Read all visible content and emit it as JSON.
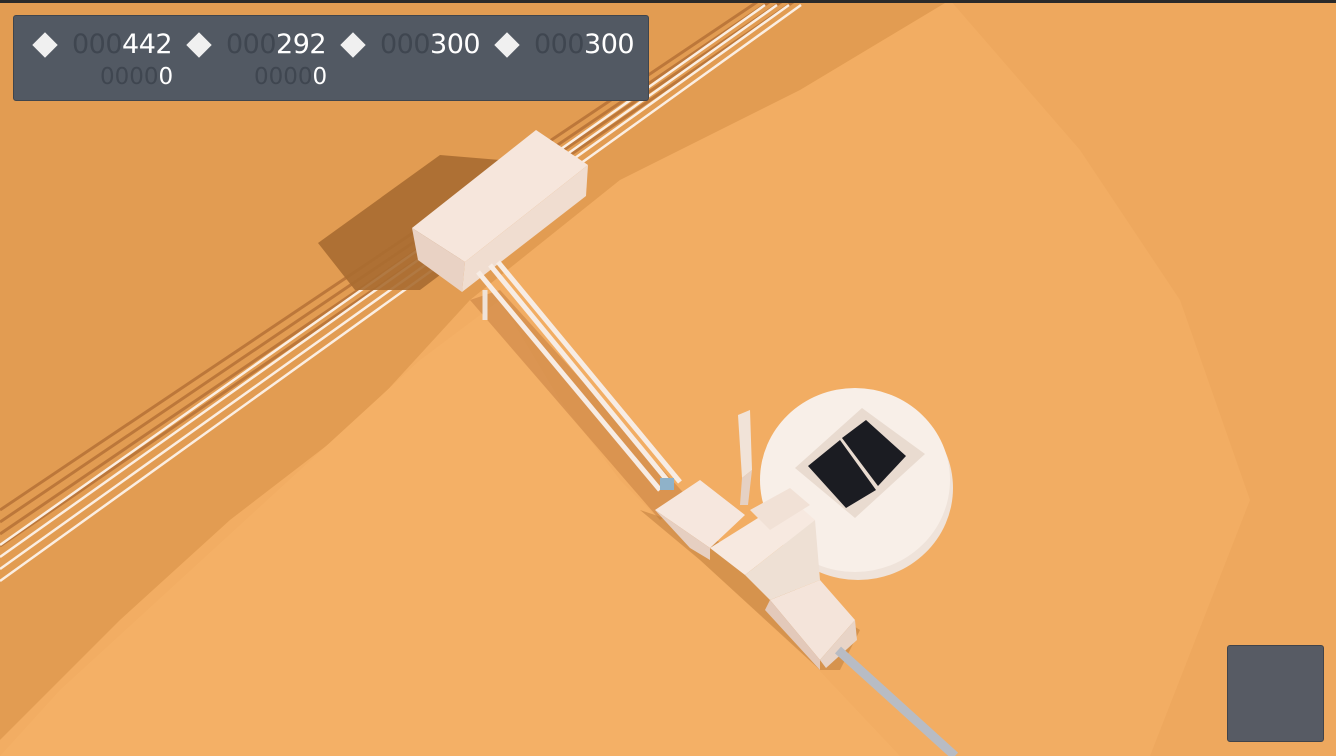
{
  "colors": {
    "ground_light": "#f4ae63",
    "ground_dark": "#e19d52",
    "building": "#f3e2d8",
    "panel": "#1b1c22",
    "hud_bg": "#525963"
  },
  "resources": [
    {
      "icon": "diamond-icon",
      "zeros": "000",
      "value": "442",
      "sub_zeros": "0000",
      "sub_value": "0"
    },
    {
      "icon": "diamond-icon",
      "zeros": "000",
      "value": "292",
      "sub_zeros": "0000",
      "sub_value": "0"
    },
    {
      "icon": "diamond-icon",
      "zeros": "000",
      "value": "300"
    },
    {
      "icon": "diamond-icon",
      "zeros": "000",
      "value": "300"
    }
  ]
}
